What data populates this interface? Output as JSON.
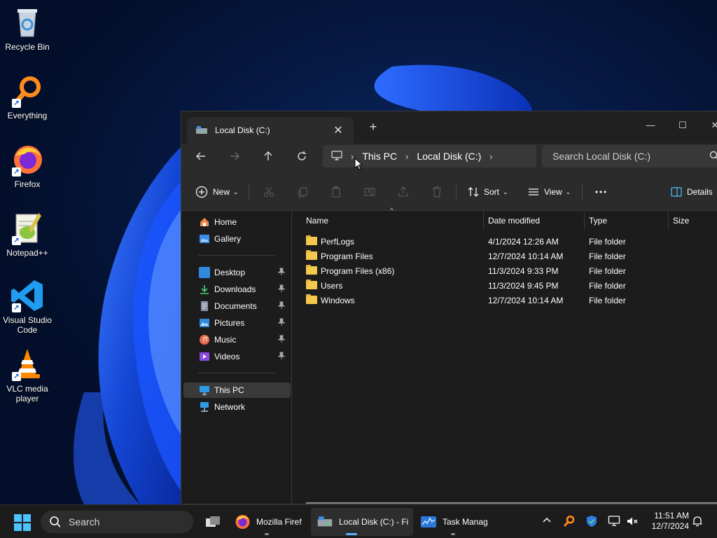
{
  "desktop": {
    "icons": [
      {
        "label": "Recycle Bin",
        "icon": "recycle-bin-icon"
      },
      {
        "label": "Everything",
        "icon": "everything-search-icon"
      },
      {
        "label": "Firefox",
        "icon": "firefox-icon"
      },
      {
        "label": "Notepad++",
        "icon": "notepad-plus-plus-icon"
      },
      {
        "label": "Visual Studio Code",
        "icon": "vscode-icon"
      },
      {
        "label": "VLC media player",
        "icon": "vlc-icon"
      }
    ]
  },
  "explorer": {
    "tab": {
      "title": "Local Disk (C:)"
    },
    "address": {
      "segments": [
        "This PC",
        "Local Disk (C:)"
      ]
    },
    "search": {
      "placeholder": "Search Local Disk (C:)"
    },
    "toolbar": {
      "new": "New",
      "sort": "Sort",
      "view": "View",
      "details": "Details"
    },
    "sidebar": {
      "top": [
        "Home",
        "Gallery"
      ],
      "pinned": [
        "Desktop",
        "Downloads",
        "Documents",
        "Pictures",
        "Music",
        "Videos"
      ],
      "bottom": [
        "This PC",
        "Network"
      ],
      "selected": "This PC"
    },
    "columns": {
      "name": "Name",
      "date": "Date modified",
      "type": "Type",
      "size": "Size"
    },
    "files": [
      {
        "name": "PerfLogs",
        "date": "4/1/2024 12:26 AM",
        "type": "File folder"
      },
      {
        "name": "Program Files",
        "date": "12/7/2024 10:14 AM",
        "type": "File folder"
      },
      {
        "name": "Program Files (x86)",
        "date": "11/3/2024 9:33 PM",
        "type": "File folder"
      },
      {
        "name": "Users",
        "date": "11/3/2024 9:45 PM",
        "type": "File folder"
      },
      {
        "name": "Windows",
        "date": "12/7/2024 10:14 AM",
        "type": "File folder"
      }
    ]
  },
  "taskbar": {
    "search_label": "Search",
    "apps": [
      {
        "label": "Mozilla Firef",
        "icon": "firefox-icon"
      },
      {
        "label": "Local Disk (C:) - Fi",
        "icon": "drive-icon"
      },
      {
        "label": "Task Manag",
        "icon": "task-manager-icon"
      }
    ],
    "clock": {
      "time": "11:51 AM",
      "date": "12/7/2024"
    }
  },
  "colors": {
    "accent": "#4cc2ff",
    "window_bg": "#1c1c1c",
    "toolbar_bg": "#2b2b2b",
    "folder": "#f3c94d",
    "taskbar_bg": "#1c1c1c"
  }
}
